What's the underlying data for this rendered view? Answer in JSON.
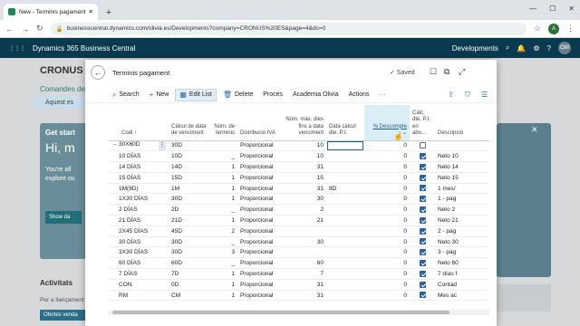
{
  "browser": {
    "tab_title": "New - Terminis pagament - Dyna",
    "url": "businesscentral.dynamics.com/olivia.es/Developments?company=CRONUS%20ES&page=4&dc=0",
    "profile_initial": "A"
  },
  "app": {
    "name": "Dynamics 365 Business Central",
    "env": "Developments",
    "user_initials": "OM"
  },
  "background": {
    "company": "CRONUS ES",
    "role_menu": "Comandes de v",
    "notice": "Aquest es",
    "get_started": "Get start",
    "greeting": "Hi, m",
    "body_text": "You're all explore ou",
    "show_button": "Show da",
    "activities": "Activitats",
    "activities_sub": "Per a llançament",
    "sales_orders": "Ofertes venda"
  },
  "dialog": {
    "title": "Terminis pagament",
    "saved": "Saved",
    "toolbar": {
      "search": "Search",
      "new": "New",
      "edit_list": "Edit List",
      "delete": "Delete",
      "process": "Procés",
      "academy": "Acadèmia Olivia",
      "actions": "Actions"
    },
    "columns": [
      "Codi",
      "Càlcul de data de venciment",
      "Núm. de terminis",
      "Distribució IVA",
      "Núm. màx. dies fins a data venciment",
      "Data càlcul dte. P.I.",
      "% Descompte",
      "Càlc. dte. P.I. en abo...",
      "Descripció"
    ],
    "rows": [
      {
        "code": "30X60D",
        "calc": "30D",
        "n": "",
        "dist": "Proporcional",
        "max": "10",
        "dte": "",
        "pct": "0",
        "chk": false,
        "desc": "",
        "arrow": "→"
      },
      {
        "code": "10 DÍAS",
        "calc": "10D",
        "n": "_",
        "dist": "Proporcional",
        "max": "10",
        "dte": "",
        "pct": "0",
        "chk": true,
        "desc": "Neto 10"
      },
      {
        "code": "14 DÍAS",
        "calc": "14D",
        "n": "1",
        "dist": "Proporcional",
        "max": "31",
        "dte": "",
        "pct": "0",
        "chk": true,
        "desc": "Neto 14"
      },
      {
        "code": "15 DÍAS",
        "calc": "15D",
        "n": "1",
        "dist": "Proporcional",
        "max": "15",
        "dte": "",
        "pct": "0",
        "chk": true,
        "desc": "Neto 15"
      },
      {
        "code": "1M(8D)",
        "calc": "1M",
        "n": "1",
        "dist": "Proporcional",
        "max": "31",
        "dte": "8D",
        "pct": "0",
        "chk": true,
        "desc": "1 mes/"
      },
      {
        "code": "1X30 DÍAS",
        "calc": "30D",
        "n": "1",
        "dist": "Proporcional",
        "max": "30",
        "dte": "",
        "pct": "0",
        "chk": true,
        "desc": "1 - pag"
      },
      {
        "code": "2 DÍAS",
        "calc": "2D",
        "n": "_",
        "dist": "Proporcional",
        "max": "2",
        "dte": "",
        "pct": "0",
        "chk": true,
        "desc": "Neto 2"
      },
      {
        "code": "21 DÍAS",
        "calc": "21D",
        "n": "1",
        "dist": "Proporcional",
        "max": "21",
        "dte": "",
        "pct": "0",
        "chk": true,
        "desc": "Neto 21"
      },
      {
        "code": "2X45 DÍAS",
        "calc": "45D",
        "n": "2",
        "dist": "Proporcional",
        "max": "",
        "dte": "",
        "pct": "0",
        "chk": true,
        "desc": "2 - pag"
      },
      {
        "code": "30 DÍAS",
        "calc": "30D",
        "n": "_",
        "dist": "Proporcional",
        "max": "30",
        "dte": "",
        "pct": "0",
        "chk": true,
        "desc": "Neto 30"
      },
      {
        "code": "3X30 DÍAS",
        "calc": "30D",
        "n": "3",
        "dist": "Proporcional",
        "max": "",
        "dte": "",
        "pct": "0",
        "chk": true,
        "desc": "3 - pag"
      },
      {
        "code": "60 DÍAS",
        "calc": "60D",
        "n": "_",
        "dist": "Proporcional",
        "max": "60",
        "dte": "",
        "pct": "0",
        "chk": true,
        "desc": "Neto 60"
      },
      {
        "code": "7 DÍAS",
        "calc": "7D",
        "n": "1",
        "dist": "Proporcional",
        "max": "7",
        "dte": "",
        "pct": "0",
        "chk": true,
        "desc": "7 días f"
      },
      {
        "code": "CON",
        "calc": "0D",
        "n": "1",
        "dist": "Proporcional",
        "max": "31",
        "dte": "",
        "pct": "0",
        "chk": true,
        "desc": "Contad"
      },
      {
        "code": "RM",
        "calc": "CM",
        "n": "1",
        "dist": "Proporcional",
        "max": "31",
        "dte": "",
        "pct": "0",
        "chk": true,
        "desc": "Mes ac"
      }
    ]
  }
}
